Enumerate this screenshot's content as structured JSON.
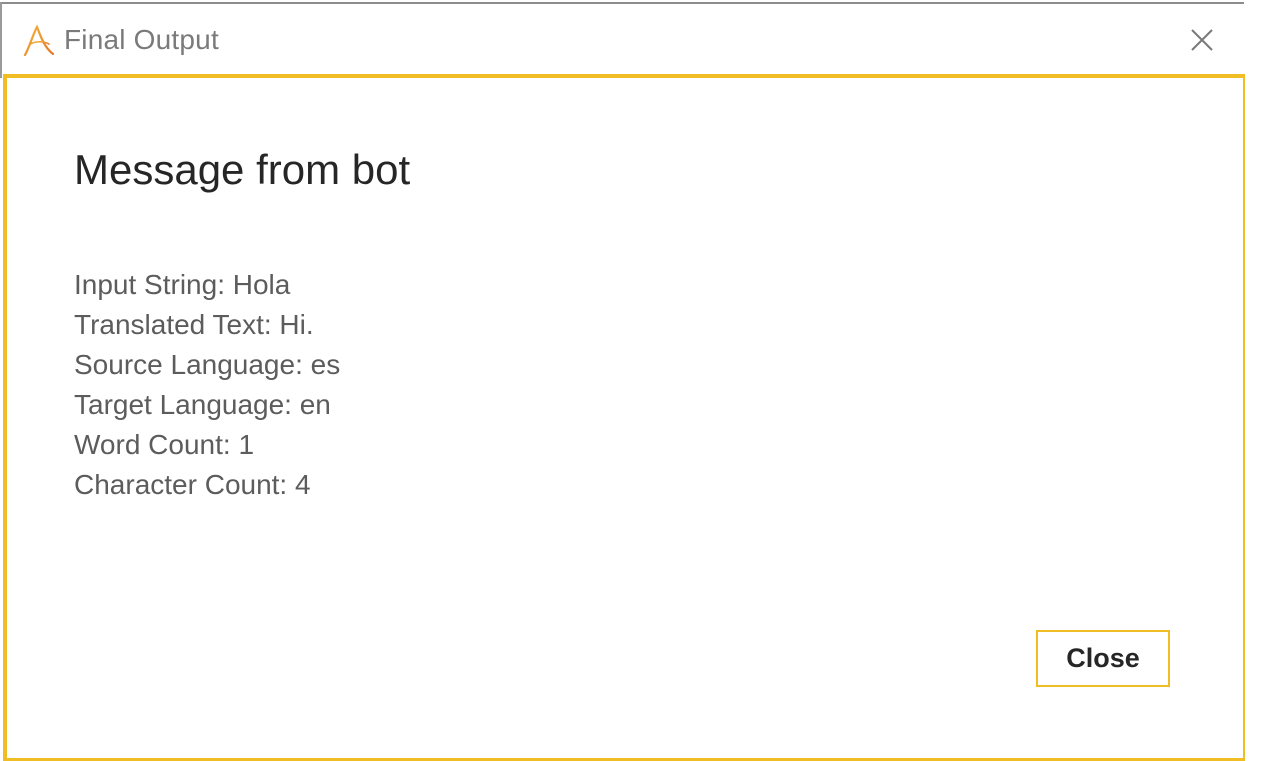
{
  "window": {
    "title": "Final Output",
    "app_icon": "alteryx-a-icon",
    "close_icon": "close-icon"
  },
  "dialog": {
    "heading": "Message from bot",
    "lines": [
      "Input String: Hola",
      "Translated Text: Hi.",
      "Source Language: es",
      "Target Language: en",
      "Word Count: 1",
      "Character Count: 4"
    ],
    "close_label": "Close"
  },
  "colors": {
    "accent": "#f0bd25",
    "heading_text": "#262626",
    "body_text": "#5c5c5c",
    "title_text": "#7a7a7a"
  }
}
